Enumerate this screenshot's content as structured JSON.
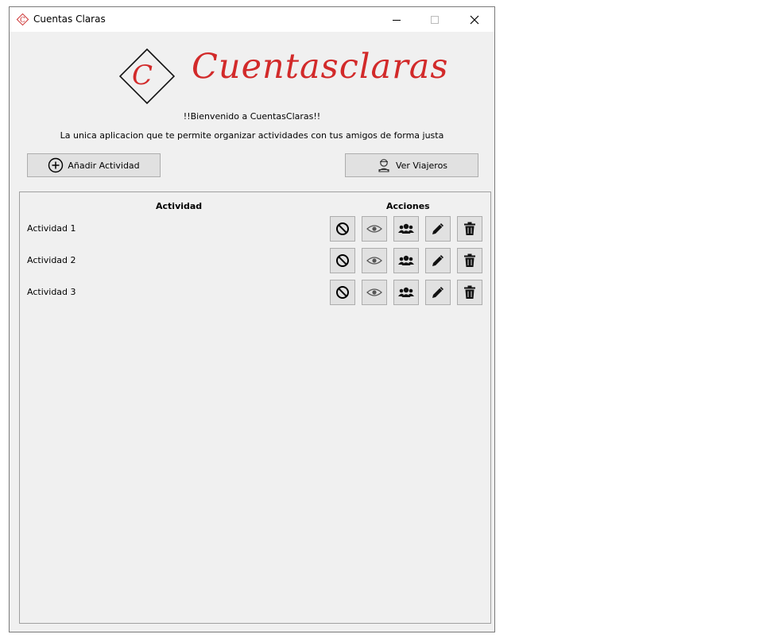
{
  "window": {
    "title": "Cuentas Claras"
  },
  "header": {
    "logo_letter": "C",
    "logo_text": "Cuentasclaras",
    "welcome": "!!Bienvenido a CuentasClaras!!",
    "subtitle": "La unica aplicacion que te permite organizar actividades con tus amigos de forma justa"
  },
  "toolbar": {
    "add_label": "Añadir Actividad",
    "travelers_label": "Ver Viajeros"
  },
  "table": {
    "col_activity": "Actividad",
    "col_actions": "Acciones",
    "rows": [
      {
        "name": "Actividad 1"
      },
      {
        "name": "Actividad 2"
      },
      {
        "name": "Actividad 3"
      }
    ],
    "actions": [
      "block-icon",
      "eye-icon",
      "users-icon",
      "pencil-icon",
      "trash-icon"
    ]
  },
  "colors": {
    "brand_red": "#d22a2a",
    "window_bg": "#f0f0f0",
    "button_bg": "#e1e1e1"
  }
}
